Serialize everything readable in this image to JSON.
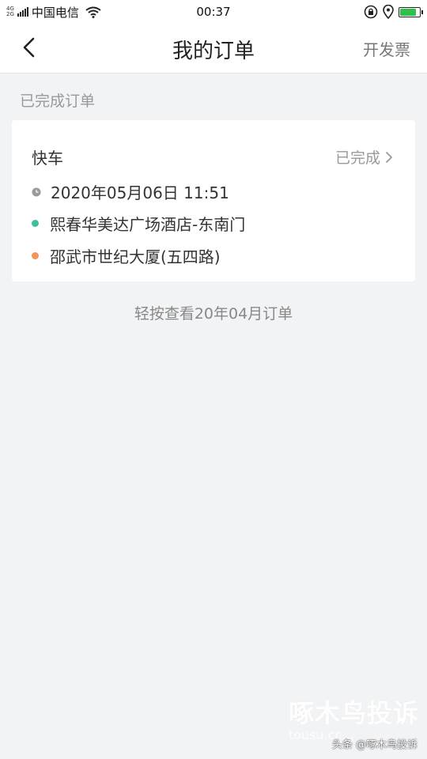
{
  "status_bar": {
    "network_top": "4G",
    "network_bottom": "2G",
    "carrier": "中国电信",
    "time": "00:37",
    "battery_level": 0.85,
    "battery_color": "#2fbf4a"
  },
  "nav": {
    "title": "我的订单",
    "action_label": "开发票",
    "back_icon": "chevron-left-icon"
  },
  "section": {
    "title": "已完成订单"
  },
  "orders": [
    {
      "type": "快车",
      "status": "已完成",
      "datetime": "2020年05月06日 11:51",
      "pickup": "熙春华美达广场酒店-东南门",
      "destination": "邵武市世纪大厦(五四路)",
      "pickup_dot_color": "#3cbf9a",
      "destination_dot_color": "#f5915a"
    }
  ],
  "more_link": "轻按查看20年04月订单",
  "watermark": {
    "main": "啄木鸟投诉",
    "url": "tousu.cc...",
    "credit": "头条 @啄木鸟投诉"
  }
}
